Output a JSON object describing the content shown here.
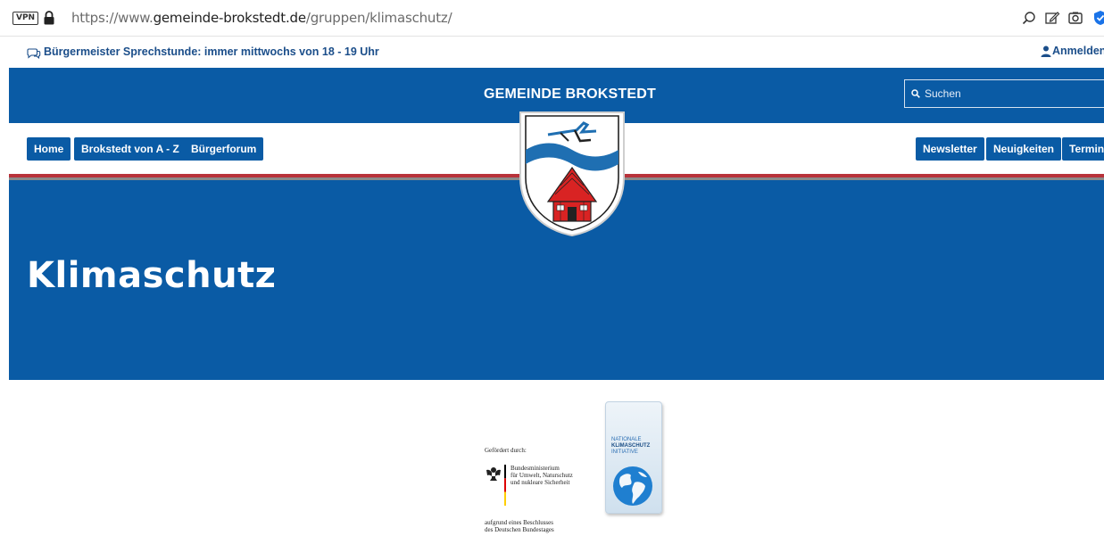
{
  "browser": {
    "vpn_label": "VPN",
    "url_base": "https://www.",
    "url_domain": "gemeinde-brokstedt.de",
    "url_path": "/gruppen/klimaschutz/"
  },
  "infobar": {
    "announcement": "Bürgermeister Sprechstunde: immer mittwochs von 18 - 19 Uhr",
    "login_label": "Anmelden"
  },
  "header": {
    "site_title": "GEMEINDE BROKSTEDT",
    "search_placeholder": "Suchen"
  },
  "nav": {
    "left": [
      "Home",
      "Brokstedt von A - Z",
      "Bürgerforum"
    ],
    "right": [
      "Newsletter",
      "Neuigkeiten",
      "Termine"
    ]
  },
  "hero": {
    "title": "Klimaschutz"
  },
  "sponsor": {
    "funded_by": "Gefördert durch:",
    "ministry_line1": "Bundesministerium",
    "ministry_line2": "für Umwelt, Naturschutz",
    "ministry_line3": "und nukleare Sicherheit",
    "resolution_line1": "aufgrund eines Beschlusses",
    "resolution_line2": "des Deutschen Bundestages",
    "nki_line1": "NATIONALE",
    "nki_line2": "KLIMASCHUTZ",
    "nki_line3": "INITIATIVE"
  },
  "colors": {
    "brand_blue": "#0a5ba5",
    "accent_red": "#b8323a",
    "text_blue": "#1b4e8a"
  }
}
